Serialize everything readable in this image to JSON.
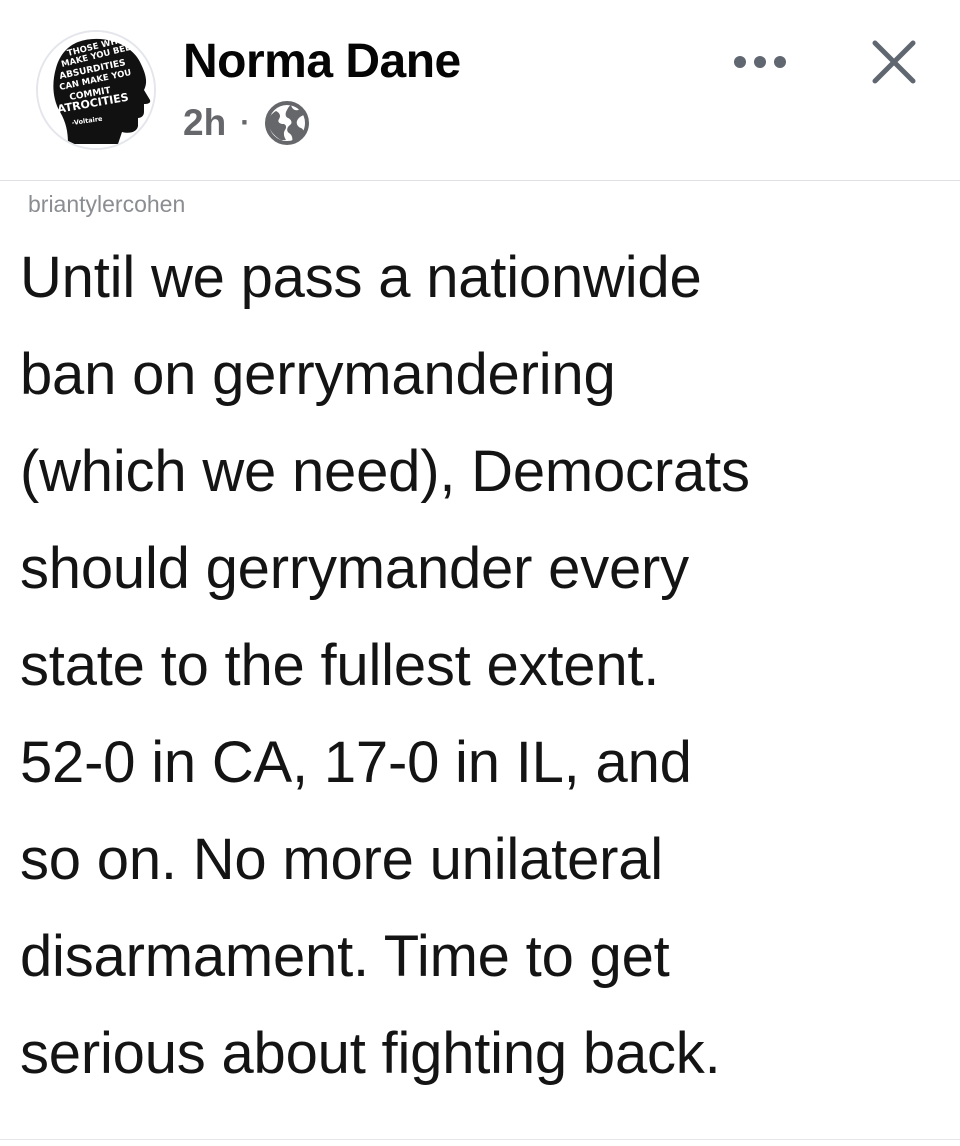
{
  "post": {
    "author": "Norma Dane",
    "timestamp": "2h",
    "separator": "·",
    "audience_icon": "globe-icon",
    "avatar": {
      "icon": "silhouette-quote-avatar",
      "quote_text": "THOSE WHO CAN MAKE YOU BELIEVE ABSURDITIES CAN MAKE YOU COMMIT ATROCITIES",
      "quote_attribution": "-Voltaire"
    },
    "actions": {
      "more_icon": "more-options-icon",
      "close_icon": "close-icon"
    }
  },
  "content": {
    "source_handle": "briantylercohen",
    "lines": [
      "Until we pass a nationwide",
      "ban on gerrymandering",
      "(which we need), Democrats",
      "should gerrymander every",
      "state to the fullest extent.",
      "52-0 in CA, 17-0 in IL, and",
      "so on. No more unilateral",
      "disarmament. Time to get",
      "serious about fighting back."
    ]
  },
  "colors": {
    "primary_text": "#050505",
    "secondary_text": "#65676b",
    "handle_text": "#8a8d91",
    "divider": "#dfe1e5",
    "background": "#ffffff"
  }
}
